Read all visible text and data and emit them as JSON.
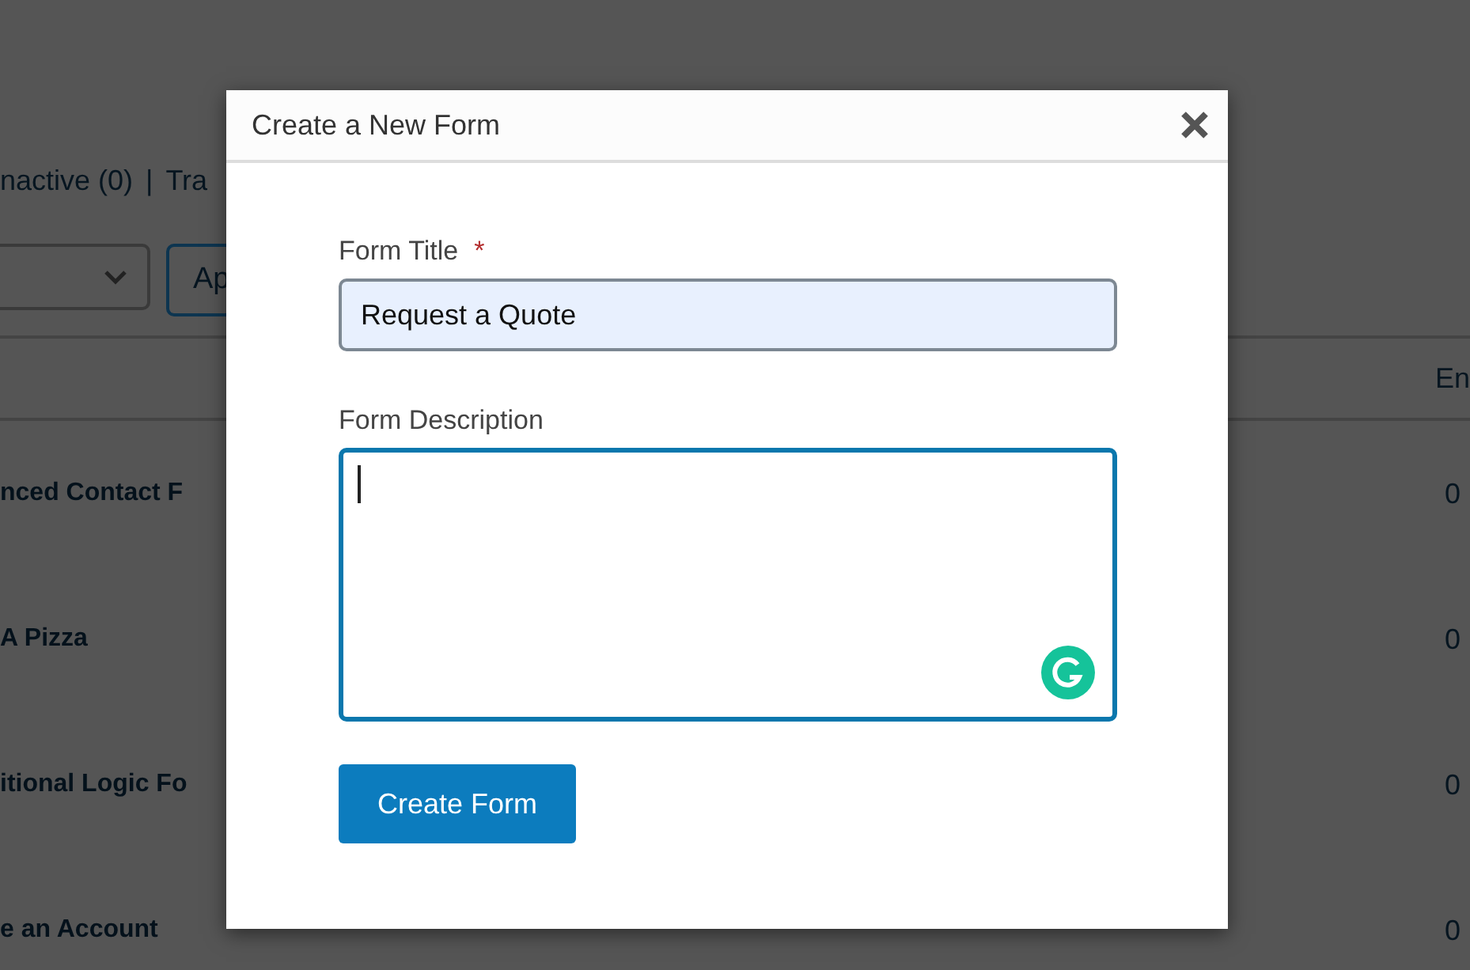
{
  "filters": {
    "items": [
      {
        "label": "nactive (0)"
      },
      {
        "label": "Tra"
      }
    ],
    "separator": "|"
  },
  "bulk_actions": {
    "apply_label": "Ap"
  },
  "table": {
    "column_2": "En",
    "rows": [
      {
        "title": "nced Contact F",
        "entries": "0"
      },
      {
        "title": "A Pizza",
        "entries": "0"
      },
      {
        "title": "itional Logic Fo",
        "entries": "0"
      },
      {
        "title": "e an Account",
        "entries": "0"
      }
    ]
  },
  "dialog": {
    "title": "Create a New Form",
    "required_mark": "*",
    "fields": [
      {
        "kind": "text",
        "label": "Form Title",
        "required": true,
        "focused": false,
        "value": "Request a Quote"
      },
      {
        "kind": "textarea",
        "label": "Form Description",
        "required": false,
        "focused": true
      }
    ],
    "submit": "Create Form"
  }
}
